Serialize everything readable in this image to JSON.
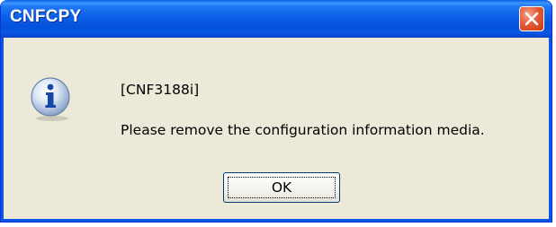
{
  "window": {
    "title": "CNFCPY",
    "close_icon": "close-icon",
    "title_color": "#ffffff",
    "titlebar_color": "#0a56e4",
    "client_color": "#ece9d8"
  },
  "dialog": {
    "icon": "info-icon",
    "code": "[CNF3188i]",
    "message": "Please remove the configuration information media."
  },
  "buttons": {
    "ok_label": "OK"
  }
}
